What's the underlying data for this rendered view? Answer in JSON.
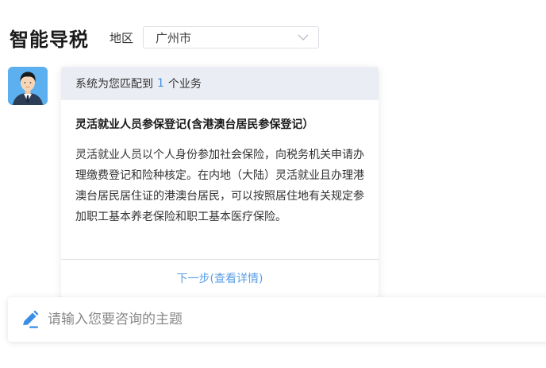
{
  "header": {
    "title": "智能导税",
    "region_label": "地区",
    "region_value": "广州市"
  },
  "card": {
    "match_prefix": "系统为您匹配到",
    "match_count": "1",
    "match_suffix": "个业务",
    "service_title": "灵活就业人员参保登记(含港澳台居民参保登记）",
    "service_description": "灵活就业人员以个人身份参加社会保险，向税务机关申请办理缴费登记和险种核定。在内地（大陆）灵活就业且办理港澳台居民居住证的港澳台居民，可以按照居住地有关规定参加职工基本养老保险和职工基本医疗保险。",
    "next_link": "下一步(查看详情)"
  },
  "input": {
    "placeholder": "请输入您要咨询的主题"
  },
  "colors": {
    "accent": "#3a8ee6",
    "link": "#5a9ee6",
    "card_header_bg": "#ebedf4",
    "avatar_bg": "#5db0f0"
  }
}
